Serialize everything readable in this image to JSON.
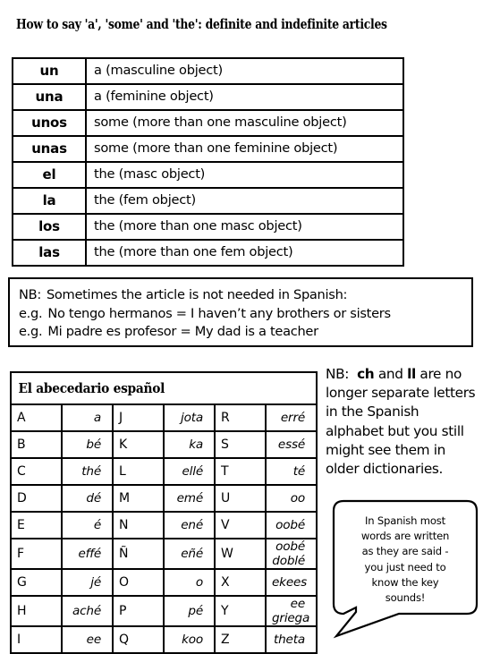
{
  "page": {
    "title": "How to say 'a', 'some' and 'the':  definite and indefinite articles"
  },
  "articles_table": {
    "rows": [
      {
        "term": "un",
        "meaning": "a (masculine object)"
      },
      {
        "term": "una",
        "meaning": "a (feminine object)"
      },
      {
        "term": "unos",
        "meaning": "some (more than one masculine object)"
      },
      {
        "term": "unas",
        "meaning": "some (more than one feminine object)"
      },
      {
        "term": "el",
        "meaning": "the (masc object)"
      },
      {
        "term": "la",
        "meaning": "the (fem object)"
      },
      {
        "term": "los",
        "meaning": "the (more than one masc object)"
      },
      {
        "term": "las",
        "meaning": "the (more than one fem object)"
      }
    ]
  },
  "nb_box": {
    "line1_lead": "NB:",
    "line1_text": "Sometimes the article is not needed in Spanish:",
    "line2_lead": "e.g.",
    "line2_text": "No tengo hermanos = I haven’t any brothers or sisters",
    "line3_lead": "e.g.",
    "line3_text": "Mi padre es profesor = My dad is a teacher"
  },
  "alphabet_table": {
    "title": "El abecedario español",
    "rows": [
      {
        "c1l": "A",
        "c1p": "a",
        "c2l": "J",
        "c2p": "jota",
        "c3l": "R",
        "c3p": "erré"
      },
      {
        "c1l": "B",
        "c1p": "bé",
        "c2l": "K",
        "c2p": "ka",
        "c3l": "S",
        "c3p": "essé"
      },
      {
        "c1l": "C",
        "c1p": "thé",
        "c2l": "L",
        "c2p": "ellé",
        "c3l": "T",
        "c3p": "té"
      },
      {
        "c1l": "D",
        "c1p": "dé",
        "c2l": "M",
        "c2p": "emé",
        "c3l": "U",
        "c3p": "oo"
      },
      {
        "c1l": "E",
        "c1p": "é",
        "c2l": "N",
        "c2p": "ené",
        "c3l": "V",
        "c3p": "oobé"
      },
      {
        "c1l": "F",
        "c1p": "effé",
        "c2l": "Ñ",
        "c2p": "eñé",
        "c3l": "W",
        "c3p": "oobé doblé"
      },
      {
        "c1l": "G",
        "c1p": "jé",
        "c2l": "O",
        "c2p": "o",
        "c3l": "X",
        "c3p": "ekees"
      },
      {
        "c1l": "H",
        "c1p": "aché",
        "c2l": "P",
        "c2p": "pé",
        "c3l": "Y",
        "c3p": "ee griega"
      },
      {
        "c1l": "I",
        "c1p": "ee",
        "c2l": "Q",
        "c2p": "koo",
        "c3l": "Z",
        "c3p": "theta"
      }
    ]
  },
  "side_note": {
    "lead": "NB:",
    "bold1": "ch",
    "mid1": " and ",
    "bold2": "ll",
    "rest": " are no longer separate letters in the Spanish alphabet but you still might see them in older dictionaries."
  },
  "speech_bubble": {
    "line1": "In Spanish most",
    "line2": "words are written",
    "line3": "as they are said -",
    "line4": "you just need to",
    "line5": "know the key",
    "line6": "sounds!"
  },
  "colors": {
    "ink": "#000000",
    "paper": "#ffffff"
  }
}
